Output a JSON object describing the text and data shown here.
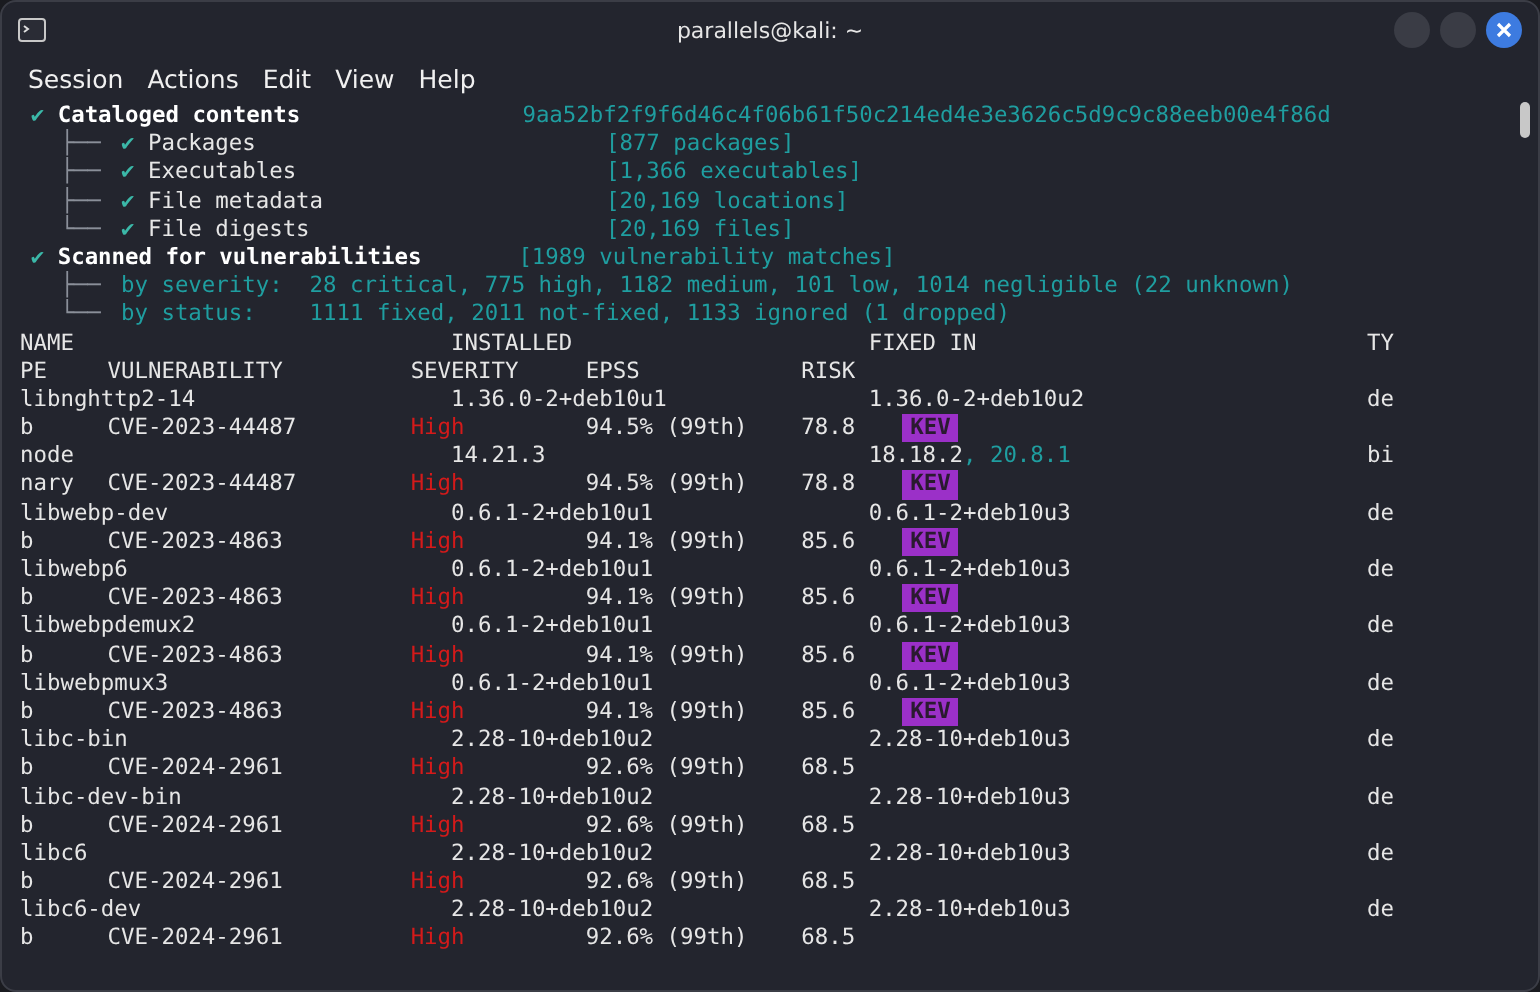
{
  "window": {
    "title": "parallels@kali: ~"
  },
  "menu": [
    "Session",
    "Actions",
    "Edit",
    "View",
    "Help"
  ],
  "summary": {
    "cataloged": {
      "check": "✔",
      "label": "Cataloged contents",
      "hash": "9aa52bf2f9f6d46c4f06b61f50c214ed4e3e3626c5d9c9c88eeb00e4f86d",
      "items": [
        {
          "branch": "├──",
          "check": "✔",
          "label": "Packages",
          "count": "[877 packages]"
        },
        {
          "branch": "├──",
          "check": "✔",
          "label": "Executables",
          "count": "[1,366 executables]"
        },
        {
          "branch": "├──",
          "check": "✔",
          "label": "File metadata",
          "count": "[20,169 locations]"
        },
        {
          "branch": "└──",
          "check": "✔",
          "label": "File digests",
          "count": "[20,169 files]"
        }
      ]
    },
    "scanned": {
      "check": "✔",
      "label": "Scanned for vulnerabilities",
      "count": "[1989 vulnerability matches]",
      "items": [
        {
          "branch": "├──",
          "label": "by severity:",
          "value": "28 critical, 775 high, 1182 medium, 101 low, 1014 negligible (22 unknown)"
        },
        {
          "branch": "└──",
          "label": "by status:",
          "value": "1111 fixed, 2011 not-fixed, 1133 ignored (1 dropped)"
        }
      ]
    }
  },
  "table": {
    "header_1": [
      "NAME",
      "INSTALLED",
      "FIXED IN",
      "TY"
    ],
    "header_2": [
      "PE",
      "VULNERABILITY",
      "SEVERITY",
      "EPSS",
      "RISK"
    ],
    "rows": [
      {
        "name": "libnghttp2-14",
        "installed": "1.36.0-2+deb10u1",
        "fixed_in": [
          "1.36.0-2+deb10u2"
        ],
        "type_1": "de",
        "type_2": "b",
        "vulnerability": "CVE-2023-44487",
        "severity": "High",
        "epss": "94.5% (99th)",
        "risk": "78.8",
        "kev": "KEV"
      },
      {
        "name": "node",
        "installed": "14.21.3",
        "fixed_in": [
          "18.18.2",
          ", 20.8.1"
        ],
        "type_1": "bi",
        "type_2": "nary",
        "vulnerability": "CVE-2023-44487",
        "severity": "High",
        "epss": "94.5% (99th)",
        "risk": "78.8",
        "kev": "KEV"
      },
      {
        "name": "libwebp-dev",
        "installed": "0.6.1-2+deb10u1",
        "fixed_in": [
          "0.6.1-2+deb10u3"
        ],
        "type_1": "de",
        "type_2": "b",
        "vulnerability": "CVE-2023-4863",
        "severity": "High",
        "epss": "94.1% (99th)",
        "risk": "85.6",
        "kev": "KEV"
      },
      {
        "name": "libwebp6",
        "installed": "0.6.1-2+deb10u1",
        "fixed_in": [
          "0.6.1-2+deb10u3"
        ],
        "type_1": "de",
        "type_2": "b",
        "vulnerability": "CVE-2023-4863",
        "severity": "High",
        "epss": "94.1% (99th)",
        "risk": "85.6",
        "kev": "KEV"
      },
      {
        "name": "libwebpdemux2",
        "installed": "0.6.1-2+deb10u1",
        "fixed_in": [
          "0.6.1-2+deb10u3"
        ],
        "type_1": "de",
        "type_2": "b",
        "vulnerability": "CVE-2023-4863",
        "severity": "High",
        "epss": "94.1% (99th)",
        "risk": "85.6",
        "kev": "KEV"
      },
      {
        "name": "libwebpmux3",
        "installed": "0.6.1-2+deb10u1",
        "fixed_in": [
          "0.6.1-2+deb10u3"
        ],
        "type_1": "de",
        "type_2": "b",
        "vulnerability": "CVE-2023-4863",
        "severity": "High",
        "epss": "94.1% (99th)",
        "risk": "85.6",
        "kev": "KEV"
      },
      {
        "name": "libc-bin",
        "installed": "2.28-10+deb10u2",
        "fixed_in": [
          "2.28-10+deb10u3"
        ],
        "type_1": "de",
        "type_2": "b",
        "vulnerability": "CVE-2024-2961",
        "severity": "High",
        "epss": "92.6% (99th)",
        "risk": "68.5"
      },
      {
        "name": "libc-dev-bin",
        "installed": "2.28-10+deb10u2",
        "fixed_in": [
          "2.28-10+deb10u3"
        ],
        "type_1": "de",
        "type_2": "b",
        "vulnerability": "CVE-2024-2961",
        "severity": "High",
        "epss": "92.6% (99th)",
        "risk": "68.5"
      },
      {
        "name": "libc6",
        "installed": "2.28-10+deb10u2",
        "fixed_in": [
          "2.28-10+deb10u3"
        ],
        "type_1": "de",
        "type_2": "b",
        "vulnerability": "CVE-2024-2961",
        "severity": "High",
        "epss": "92.6% (99th)",
        "risk": "68.5"
      },
      {
        "name": "libc6-dev",
        "installed": "2.28-10+deb10u2",
        "fixed_in": [
          "2.28-10+deb10u3"
        ],
        "type_1": "de",
        "type_2": "b",
        "vulnerability": "CVE-2024-2961",
        "severity": "High",
        "epss": "92.6% (99th)",
        "risk": "68.5"
      }
    ]
  }
}
